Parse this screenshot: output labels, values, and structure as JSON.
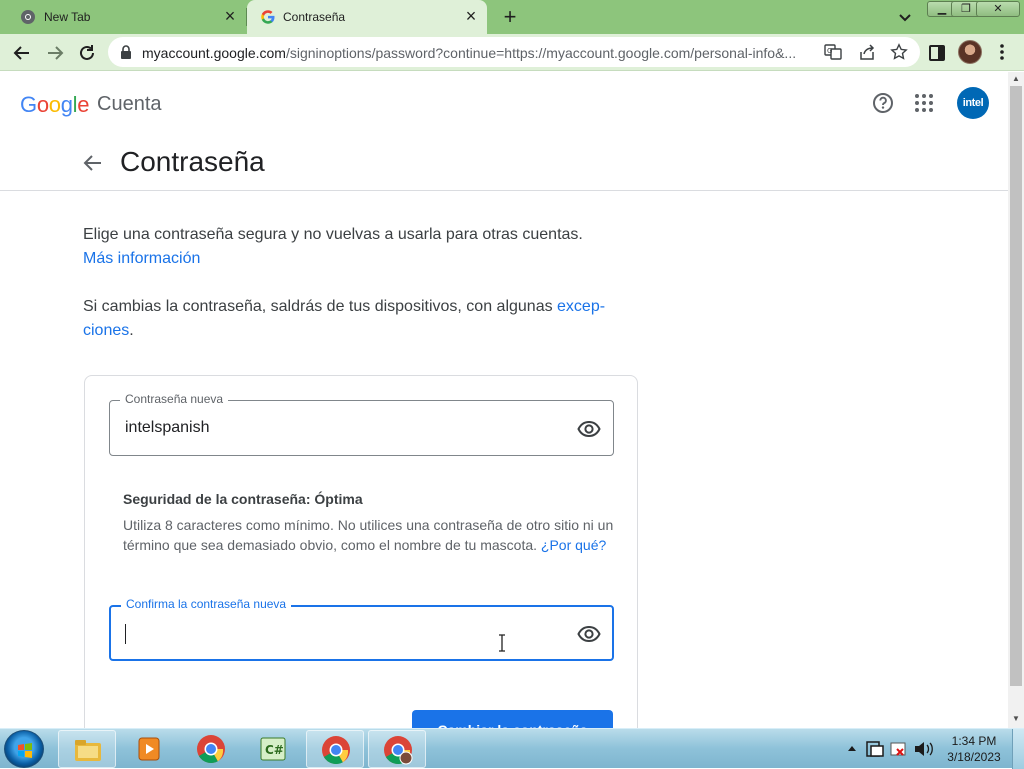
{
  "browser": {
    "tabs": [
      {
        "title": "New Tab",
        "active": false
      },
      {
        "title": "Contraseña",
        "active": true
      }
    ],
    "url_main": "myaccount.google.com",
    "url_rest": "/signinoptions/password?continue=https://myaccount.google.com/personal-info&...",
    "theme_color": "#8dc57c",
    "toolbar_color": "#dff0d8"
  },
  "header": {
    "logo_letters": [
      "G",
      "o",
      "o",
      "g",
      "l",
      "e"
    ],
    "logo_colors": [
      "#4285f4",
      "#ea4335",
      "#fbbc05",
      "#4285f4",
      "#34a853",
      "#ea4335"
    ],
    "product": "Cuenta",
    "account_avatar_text": "intel",
    "account_avatar_color": "#0068b5"
  },
  "page": {
    "title": "Contraseña",
    "intro": "Elige una contraseña segura y no vuelvas a usarla para otras cuentas.",
    "intro_link": "Más información",
    "signout_text": "Si cambias la contraseña, saldrás de tus dispositivos, con algunas ",
    "signout_link": "excep­ciones",
    "signout_end": "."
  },
  "form": {
    "new_password_label": "Contraseña nueva",
    "new_password_value": "intelspanish",
    "strength_label": "Seguridad de la contraseña: ",
    "strength_value": "Óptima",
    "strength_help": "Utiliza 8 caracteres como mínimo. No utilices una contraseña de otro sitio ni un término que sea demasiado obvio, como el nombre de tu mascota. ",
    "strength_help_link": "¿Por qué?",
    "confirm_label": "Confirma la contraseña nueva",
    "confirm_value": "",
    "submit_label": "Cambiar la contraseña",
    "accent_color": "#1a73e8"
  },
  "taskbar": {
    "clock_time": "1:34 PM",
    "clock_date": "3/18/2023"
  }
}
